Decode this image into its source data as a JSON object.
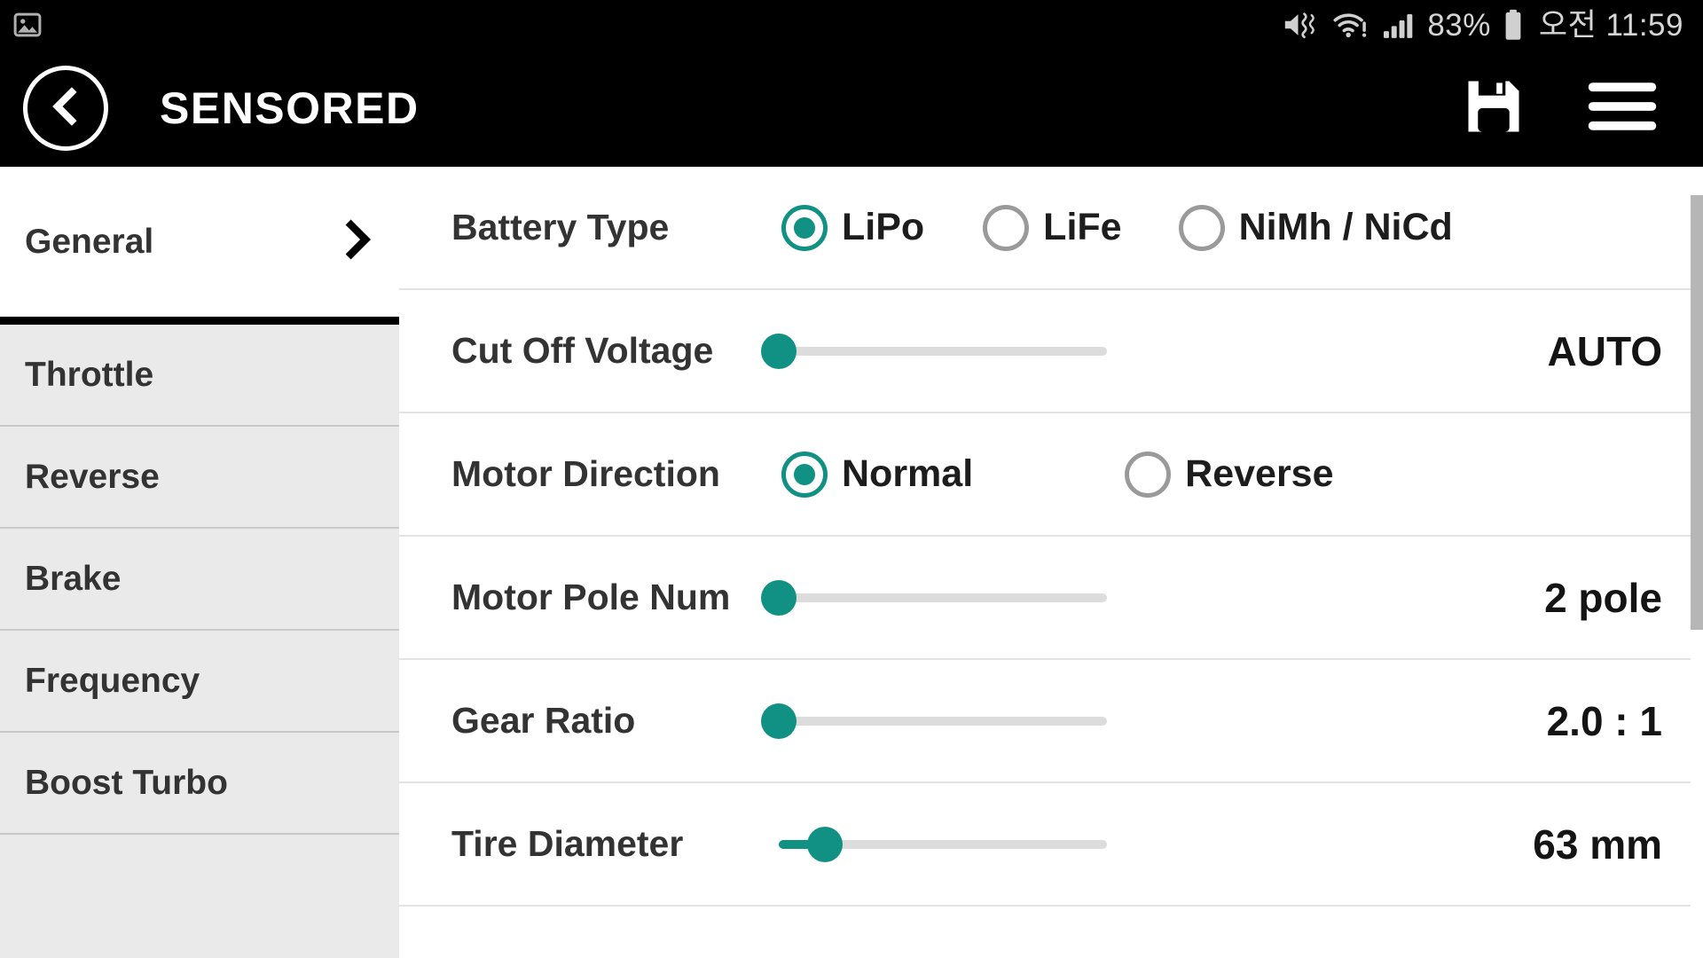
{
  "statusbar": {
    "left_icon": "image-notification-icon",
    "icons": [
      "mute-icon",
      "wifi-warning-icon",
      "signal-bars-icon",
      "battery-icon"
    ],
    "battery_percent": "83%",
    "time": "오전 11:59"
  },
  "header": {
    "back_icon": "chevron-left-icon",
    "title": "SENSORED",
    "save_icon": "save-floppy-icon",
    "menu_icon": "hamburger-menu-icon"
  },
  "sidebar": {
    "items": [
      {
        "label": "General",
        "active": true,
        "chevron": "chevron-right-icon"
      },
      {
        "label": "Throttle",
        "active": false
      },
      {
        "label": "Reverse",
        "active": false
      },
      {
        "label": "Brake",
        "active": false
      },
      {
        "label": "Frequency",
        "active": false
      },
      {
        "label": "Boost Turbo",
        "active": false
      }
    ]
  },
  "main": {
    "rows": [
      {
        "label": "Battery Type",
        "type": "radio",
        "options": [
          {
            "label": "LiPo",
            "selected": true
          },
          {
            "label": "LiFe",
            "selected": false
          },
          {
            "label": "NiMh / NiCd",
            "selected": false
          }
        ]
      },
      {
        "label": "Cut Off Voltage",
        "type": "slider",
        "percent": 0,
        "value": "AUTO"
      },
      {
        "label": "Motor Direction",
        "type": "radio",
        "options": [
          {
            "label": "Normal",
            "selected": true
          },
          {
            "label": "Reverse",
            "selected": false
          }
        ]
      },
      {
        "label": "Motor Pole Num",
        "type": "slider",
        "percent": 0,
        "value": "2 pole"
      },
      {
        "label": "Gear Ratio",
        "type": "slider",
        "percent": 0,
        "value": "2.0 : 1"
      },
      {
        "label": "Tire Diameter",
        "type": "slider",
        "percent": 14,
        "value": "63 mm"
      }
    ]
  },
  "colors": {
    "accent": "#109184",
    "header_bg": "#000000",
    "sidebar_bg": "#eaeaea",
    "active_bg": "#ffffff",
    "text": "#333333",
    "track": "#dcdcdc"
  },
  "scrollbar": {
    "thumb_color": "#b6b6b6"
  }
}
